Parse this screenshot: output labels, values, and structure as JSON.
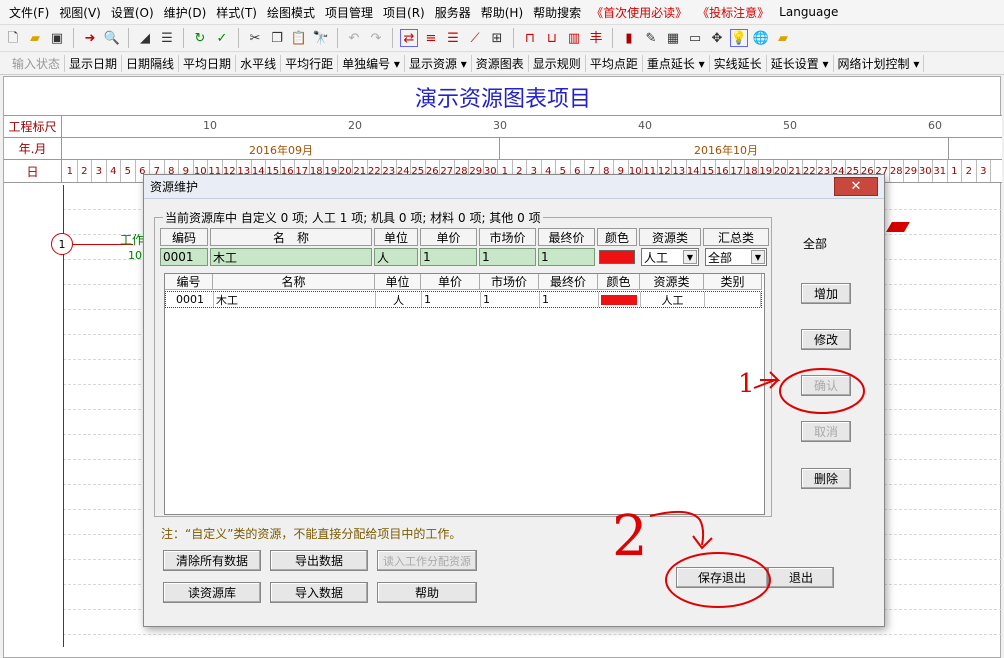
{
  "menu": [
    "文件(F)",
    "视图(V)",
    "设置(O)",
    "维护(D)",
    "样式(T)",
    "绘图模式",
    "项目管理",
    "项目(R)",
    "服务器",
    "帮助(H)",
    "帮助搜索",
    "《首次使用必读》",
    "《投标注意》",
    "Language"
  ],
  "toolbar2": [
    "输入状态",
    "显示日期",
    "日期隔线",
    "平均日期",
    "水平线",
    "平均行距",
    "单独编号 ▾",
    "显示资源 ▾",
    "资源图表",
    "显示规则",
    "平均点距",
    "重点延长 ▾",
    "实线延长",
    "延长设置 ▾",
    "网络计划控制 ▾"
  ],
  "chart": {
    "title": "演示资源图表项目",
    "row_labels": [
      "工程标尺",
      "年.月",
      "日"
    ],
    "scale": [
      "10",
      "20",
      "30",
      "40",
      "50",
      "60"
    ],
    "months": [
      "2016年09月",
      "2016年10月"
    ],
    "days": [
      "1",
      "2",
      "3",
      "4",
      "5",
      "6",
      "7",
      "8",
      "9",
      "10",
      "11",
      "12",
      "13",
      "14",
      "15",
      "16",
      "17",
      "18",
      "19",
      "20",
      "21",
      "22",
      "23",
      "24",
      "25",
      "26",
      "27",
      "28",
      "29",
      "30",
      "1",
      "2",
      "3",
      "4",
      "5",
      "6",
      "7",
      "8",
      "9",
      "10",
      "11",
      "12",
      "13",
      "14",
      "15",
      "16",
      "17",
      "18",
      "19",
      "20",
      "21",
      "22",
      "23",
      "24",
      "25",
      "26",
      "27",
      "28",
      "29",
      "30",
      "31",
      "1",
      "2",
      "3"
    ],
    "node": "1",
    "work_label": "工作",
    "work_num": "10"
  },
  "dialog": {
    "title": "资源维护",
    "close": "✕",
    "group_legend": "当前资源库中 自定义 0 项; 人工 1 项; 机具 0 项; 材料 0 项; 其他 0 项",
    "edit_headers": [
      "编码",
      "名　称",
      "单位",
      "单价",
      "市场价",
      "最终价",
      "颜色",
      "资源类",
      "汇总类"
    ],
    "edit_values": {
      "code": "0001",
      "name": "木工",
      "unit": "人",
      "price": "1",
      "market": "1",
      "final": "1",
      "type": "人工",
      "summary": "全部"
    },
    "list_headers": [
      "编号",
      "名称",
      "单位",
      "单价",
      "市场价",
      "最终价",
      "颜色",
      "资源类",
      "类别"
    ],
    "list_row": {
      "code": "0001",
      "name": "木工",
      "unit": "人",
      "price": "1",
      "market": "1",
      "final": "1",
      "type": "人工",
      "cat": ""
    },
    "all_label": "全部",
    "buttons_right": {
      "add": "增加",
      "modify": "修改",
      "confirm": "确认",
      "cancel": "取消",
      "delete": "删除"
    },
    "note": "注：“自定义”类的资源，不能直接分配给项目中的工作。",
    "buttons_bottom": {
      "clear": "清除所有数据",
      "export": "导出数据",
      "import_work": "读入工作分配资源",
      "read_lib": "读资源库",
      "import": "导入数据",
      "help": "帮助",
      "save_exit": "保存退出",
      "exit": "退出"
    }
  },
  "annotations": {
    "a1": "1",
    "a2": "2"
  },
  "colors": {
    "accent_red": "#d40000",
    "title_blue": "#2222cc",
    "edit_green": "#c8e6c8"
  }
}
